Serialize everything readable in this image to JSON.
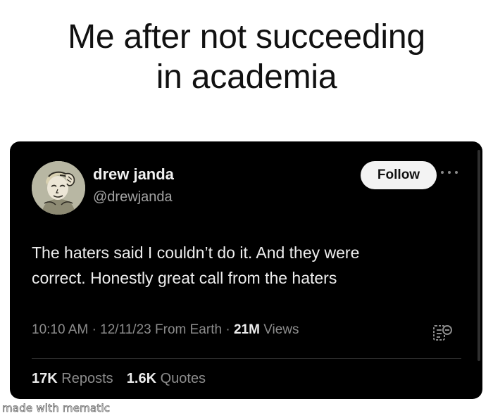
{
  "caption": {
    "line1": "Me after not succeeding",
    "line2": "in academia"
  },
  "tweet": {
    "display_name": "drew janda",
    "handle": "@drewjanda",
    "follow_label": "Follow",
    "text_line1": "The haters said I couldn’t do it. And they were",
    "text_line2": "correct. Honestly great call from the haters",
    "time": "10:10 AM",
    "date": "12/11/23",
    "source": "From Earth",
    "views_count": "21M",
    "views_label": "Views",
    "reposts_count": "17K",
    "reposts_label": "Reposts",
    "quotes_count": "1.6K",
    "quotes_label": "Quotes",
    "avatar_icon": "illustrated-face-avatar",
    "more_icon": "more-options-icon",
    "stats_icon": "post-analytics-icon"
  },
  "watermark": "made with mematic",
  "colors": {
    "card_background": "#000000",
    "primary_text": "#ededed",
    "secondary_text": "#8c8c8c",
    "follow_button_bg": "#f3f3f3"
  }
}
